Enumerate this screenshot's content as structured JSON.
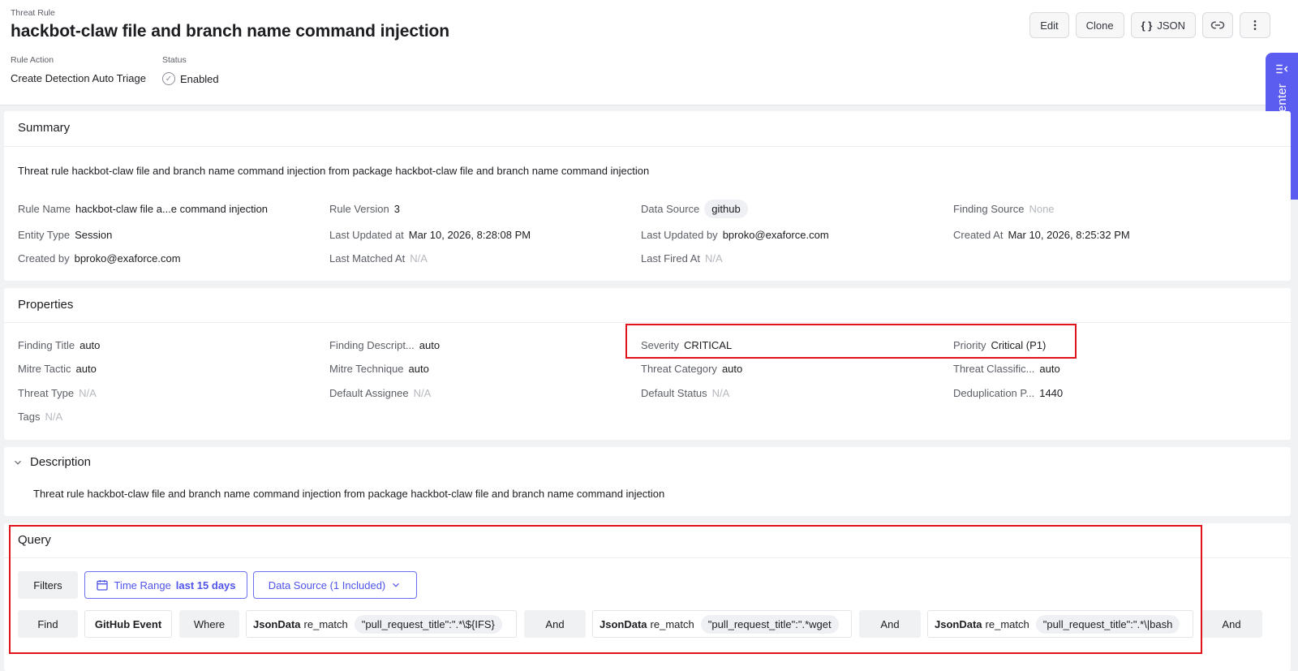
{
  "header": {
    "eyebrow": "Threat Rule",
    "title": "hackbot-claw file and branch name command injection",
    "rule_action_label": "Rule Action",
    "rule_action_value": "Create Detection Auto Triage",
    "status_label": "Status",
    "status_value": "Enabled",
    "buttons": {
      "edit": "Edit",
      "clone": "Clone",
      "json": "JSON",
      "json_icon": "{ }"
    }
  },
  "command_center": {
    "label": "Command Center"
  },
  "summary": {
    "title": "Summary",
    "text": "Threat rule hackbot-claw file and branch name command injection from package hackbot-claw file and branch name command injection",
    "fields": [
      {
        "k": "Rule Name",
        "v": "hackbot-claw file a...e command injection"
      },
      {
        "k": "Rule Version",
        "v": "3"
      },
      {
        "k": "Data Source",
        "v": "github"
      },
      {
        "k": "Finding Source",
        "v": "None"
      },
      {
        "k": "Entity Type",
        "v": "Session"
      },
      {
        "k": "Last Updated at",
        "v": "Mar 10, 2026, 8:28:08 PM"
      },
      {
        "k": "Last Updated by",
        "v": "bproko@exaforce.com"
      },
      {
        "k": "Created At",
        "v": "Mar 10, 2026, 8:25:32 PM"
      },
      {
        "k": "Created by",
        "v": "bproko@exaforce.com"
      },
      {
        "k": "Last Matched At",
        "v": "N/A"
      },
      {
        "k": "Last Fired At",
        "v": "N/A"
      }
    ]
  },
  "properties": {
    "title": "Properties",
    "fields": [
      {
        "k": "Finding Title",
        "v": "auto"
      },
      {
        "k": "Finding Descript...",
        "v": "auto"
      },
      {
        "k": "Severity",
        "v": "CRITICAL"
      },
      {
        "k": "Priority",
        "v": "Critical (P1)"
      },
      {
        "k": "Mitre Tactic",
        "v": "auto"
      },
      {
        "k": "Mitre Technique",
        "v": "auto"
      },
      {
        "k": "Threat Category",
        "v": "auto"
      },
      {
        "k": "Threat Classific...",
        "v": "auto"
      },
      {
        "k": "Threat Type",
        "v": "N/A"
      },
      {
        "k": "Default Assignee",
        "v": "N/A"
      },
      {
        "k": "Default Status",
        "v": "N/A"
      },
      {
        "k": "Deduplication P...",
        "v": "1440"
      },
      {
        "k": "Tags",
        "v": "N/A"
      }
    ]
  },
  "description": {
    "title": "Description",
    "text": "Threat rule hackbot-claw file and branch name command injection from package hackbot-claw file and branch name command injection"
  },
  "query": {
    "title": "Query",
    "filters_label": "Filters",
    "time_range_label": "Time Range",
    "time_range_value": "last 15 days",
    "data_source_label": "Data Source (1 Included)",
    "find_label": "Find",
    "entity": "GitHub Event",
    "where_label": "Where",
    "and_label": "And",
    "conditions": [
      {
        "field": "JsonData",
        "op": "re_match",
        "value": "\"pull_request_title\":\".*\\${IFS}"
      },
      {
        "field": "JsonData",
        "op": "re_match",
        "value": "\"pull_request_title\":\".*wget"
      },
      {
        "field": "JsonData",
        "op": "re_match",
        "value": "\"pull_request_title\":\".*\\|bash"
      }
    ]
  }
}
